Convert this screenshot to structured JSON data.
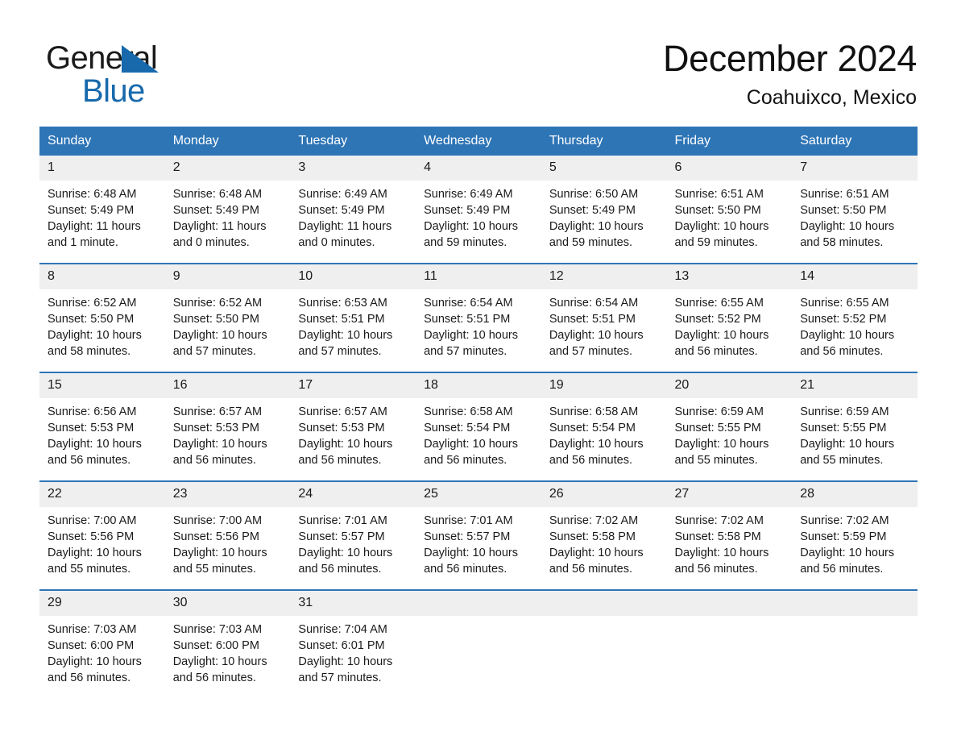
{
  "brand": {
    "line1": "General",
    "line2": "Blue",
    "triangle_color": "#1769AC",
    "accent_color": "#2E75B6"
  },
  "header": {
    "title": "December 2024",
    "location": "Coahuixco, Mexico"
  },
  "calendar": {
    "weekdays": [
      "Sunday",
      "Monday",
      "Tuesday",
      "Wednesday",
      "Thursday",
      "Friday",
      "Saturday"
    ],
    "weeks": [
      [
        {
          "day": "1",
          "sunrise": "Sunrise: 6:48 AM",
          "sunset": "Sunset: 5:49 PM",
          "daylight_line1": "Daylight: 11 hours",
          "daylight_line2": "and 1 minute."
        },
        {
          "day": "2",
          "sunrise": "Sunrise: 6:48 AM",
          "sunset": "Sunset: 5:49 PM",
          "daylight_line1": "Daylight: 11 hours",
          "daylight_line2": "and 0 minutes."
        },
        {
          "day": "3",
          "sunrise": "Sunrise: 6:49 AM",
          "sunset": "Sunset: 5:49 PM",
          "daylight_line1": "Daylight: 11 hours",
          "daylight_line2": "and 0 minutes."
        },
        {
          "day": "4",
          "sunrise": "Sunrise: 6:49 AM",
          "sunset": "Sunset: 5:49 PM",
          "daylight_line1": "Daylight: 10 hours",
          "daylight_line2": "and 59 minutes."
        },
        {
          "day": "5",
          "sunrise": "Sunrise: 6:50 AM",
          "sunset": "Sunset: 5:49 PM",
          "daylight_line1": "Daylight: 10 hours",
          "daylight_line2": "and 59 minutes."
        },
        {
          "day": "6",
          "sunrise": "Sunrise: 6:51 AM",
          "sunset": "Sunset: 5:50 PM",
          "daylight_line1": "Daylight: 10 hours",
          "daylight_line2": "and 59 minutes."
        },
        {
          "day": "7",
          "sunrise": "Sunrise: 6:51 AM",
          "sunset": "Sunset: 5:50 PM",
          "daylight_line1": "Daylight: 10 hours",
          "daylight_line2": "and 58 minutes."
        }
      ],
      [
        {
          "day": "8",
          "sunrise": "Sunrise: 6:52 AM",
          "sunset": "Sunset: 5:50 PM",
          "daylight_line1": "Daylight: 10 hours",
          "daylight_line2": "and 58 minutes."
        },
        {
          "day": "9",
          "sunrise": "Sunrise: 6:52 AM",
          "sunset": "Sunset: 5:50 PM",
          "daylight_line1": "Daylight: 10 hours",
          "daylight_line2": "and 57 minutes."
        },
        {
          "day": "10",
          "sunrise": "Sunrise: 6:53 AM",
          "sunset": "Sunset: 5:51 PM",
          "daylight_line1": "Daylight: 10 hours",
          "daylight_line2": "and 57 minutes."
        },
        {
          "day": "11",
          "sunrise": "Sunrise: 6:54 AM",
          "sunset": "Sunset: 5:51 PM",
          "daylight_line1": "Daylight: 10 hours",
          "daylight_line2": "and 57 minutes."
        },
        {
          "day": "12",
          "sunrise": "Sunrise: 6:54 AM",
          "sunset": "Sunset: 5:51 PM",
          "daylight_line1": "Daylight: 10 hours",
          "daylight_line2": "and 57 minutes."
        },
        {
          "day": "13",
          "sunrise": "Sunrise: 6:55 AM",
          "sunset": "Sunset: 5:52 PM",
          "daylight_line1": "Daylight: 10 hours",
          "daylight_line2": "and 56 minutes."
        },
        {
          "day": "14",
          "sunrise": "Sunrise: 6:55 AM",
          "sunset": "Sunset: 5:52 PM",
          "daylight_line1": "Daylight: 10 hours",
          "daylight_line2": "and 56 minutes."
        }
      ],
      [
        {
          "day": "15",
          "sunrise": "Sunrise: 6:56 AM",
          "sunset": "Sunset: 5:53 PM",
          "daylight_line1": "Daylight: 10 hours",
          "daylight_line2": "and 56 minutes."
        },
        {
          "day": "16",
          "sunrise": "Sunrise: 6:57 AM",
          "sunset": "Sunset: 5:53 PM",
          "daylight_line1": "Daylight: 10 hours",
          "daylight_line2": "and 56 minutes."
        },
        {
          "day": "17",
          "sunrise": "Sunrise: 6:57 AM",
          "sunset": "Sunset: 5:53 PM",
          "daylight_line1": "Daylight: 10 hours",
          "daylight_line2": "and 56 minutes."
        },
        {
          "day": "18",
          "sunrise": "Sunrise: 6:58 AM",
          "sunset": "Sunset: 5:54 PM",
          "daylight_line1": "Daylight: 10 hours",
          "daylight_line2": "and 56 minutes."
        },
        {
          "day": "19",
          "sunrise": "Sunrise: 6:58 AM",
          "sunset": "Sunset: 5:54 PM",
          "daylight_line1": "Daylight: 10 hours",
          "daylight_line2": "and 56 minutes."
        },
        {
          "day": "20",
          "sunrise": "Sunrise: 6:59 AM",
          "sunset": "Sunset: 5:55 PM",
          "daylight_line1": "Daylight: 10 hours",
          "daylight_line2": "and 55 minutes."
        },
        {
          "day": "21",
          "sunrise": "Sunrise: 6:59 AM",
          "sunset": "Sunset: 5:55 PM",
          "daylight_line1": "Daylight: 10 hours",
          "daylight_line2": "and 55 minutes."
        }
      ],
      [
        {
          "day": "22",
          "sunrise": "Sunrise: 7:00 AM",
          "sunset": "Sunset: 5:56 PM",
          "daylight_line1": "Daylight: 10 hours",
          "daylight_line2": "and 55 minutes."
        },
        {
          "day": "23",
          "sunrise": "Sunrise: 7:00 AM",
          "sunset": "Sunset: 5:56 PM",
          "daylight_line1": "Daylight: 10 hours",
          "daylight_line2": "and 55 minutes."
        },
        {
          "day": "24",
          "sunrise": "Sunrise: 7:01 AM",
          "sunset": "Sunset: 5:57 PM",
          "daylight_line1": "Daylight: 10 hours",
          "daylight_line2": "and 56 minutes."
        },
        {
          "day": "25",
          "sunrise": "Sunrise: 7:01 AM",
          "sunset": "Sunset: 5:57 PM",
          "daylight_line1": "Daylight: 10 hours",
          "daylight_line2": "and 56 minutes."
        },
        {
          "day": "26",
          "sunrise": "Sunrise: 7:02 AM",
          "sunset": "Sunset: 5:58 PM",
          "daylight_line1": "Daylight: 10 hours",
          "daylight_line2": "and 56 minutes."
        },
        {
          "day": "27",
          "sunrise": "Sunrise: 7:02 AM",
          "sunset": "Sunset: 5:58 PM",
          "daylight_line1": "Daylight: 10 hours",
          "daylight_line2": "and 56 minutes."
        },
        {
          "day": "28",
          "sunrise": "Sunrise: 7:02 AM",
          "sunset": "Sunset: 5:59 PM",
          "daylight_line1": "Daylight: 10 hours",
          "daylight_line2": "and 56 minutes."
        }
      ],
      [
        {
          "day": "29",
          "sunrise": "Sunrise: 7:03 AM",
          "sunset": "Sunset: 6:00 PM",
          "daylight_line1": "Daylight: 10 hours",
          "daylight_line2": "and 56 minutes."
        },
        {
          "day": "30",
          "sunrise": "Sunrise: 7:03 AM",
          "sunset": "Sunset: 6:00 PM",
          "daylight_line1": "Daylight: 10 hours",
          "daylight_line2": "and 56 minutes."
        },
        {
          "day": "31",
          "sunrise": "Sunrise: 7:04 AM",
          "sunset": "Sunset: 6:01 PM",
          "daylight_line1": "Daylight: 10 hours",
          "daylight_line2": "and 57 minutes."
        },
        {
          "day": "",
          "sunrise": "",
          "sunset": "",
          "daylight_line1": "",
          "daylight_line2": ""
        },
        {
          "day": "",
          "sunrise": "",
          "sunset": "",
          "daylight_line1": "",
          "daylight_line2": ""
        },
        {
          "day": "",
          "sunrise": "",
          "sunset": "",
          "daylight_line1": "",
          "daylight_line2": ""
        },
        {
          "day": "",
          "sunrise": "",
          "sunset": "",
          "daylight_line1": "",
          "daylight_line2": ""
        }
      ]
    ]
  }
}
